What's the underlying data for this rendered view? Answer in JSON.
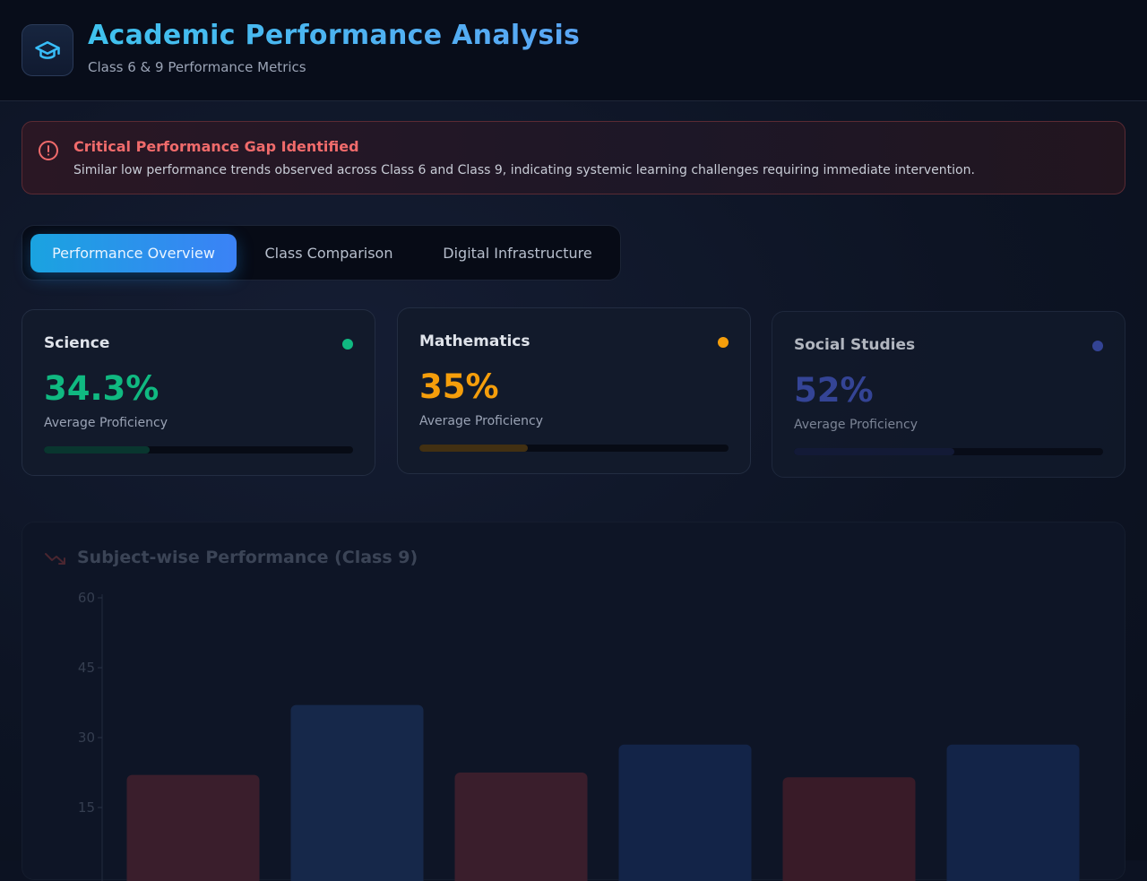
{
  "header": {
    "title": "Academic Performance Analysis",
    "subtitle": "Class 6 & 9 Performance Metrics",
    "logo_icon": "graduation-cap-icon"
  },
  "alert": {
    "icon": "alert-circle-icon",
    "title": "Critical Performance Gap Identified",
    "text": "Similar low performance trends observed across Class 6 and Class 9, indicating systemic learning challenges requiring immediate intervention."
  },
  "tabs": [
    {
      "label": "Performance Overview",
      "active": true
    },
    {
      "label": "Class Comparison",
      "active": false
    },
    {
      "label": "Digital Infrastructure",
      "active": false
    }
  ],
  "cards": [
    {
      "title": "Science",
      "value": "34.3%",
      "label": "Average Proficiency",
      "color": "#10b981",
      "fill_fraction": 0.343
    },
    {
      "title": "Mathematics",
      "value": "35%",
      "label": "Average Proficiency",
      "color": "#f59e0b",
      "fill_fraction": 0.35
    },
    {
      "title": "Social Studies",
      "value": "52%",
      "label": "Average Proficiency",
      "color": "#3f51b5",
      "fill_fraction": 0.52
    }
  ],
  "chart_data": {
    "type": "bar",
    "title": "Subject-wise Performance (Class 9)",
    "ylim": [
      0,
      60
    ],
    "yticks": [
      15,
      30,
      45,
      60
    ],
    "grid": false,
    "values": [
      22,
      37,
      22.5,
      28.5,
      21.5,
      28.5
    ],
    "bar_colors": [
      "#3a1e2c",
      "#16284a",
      "#3a1e2c",
      "#132448",
      "#391b28",
      "#132448"
    ]
  }
}
